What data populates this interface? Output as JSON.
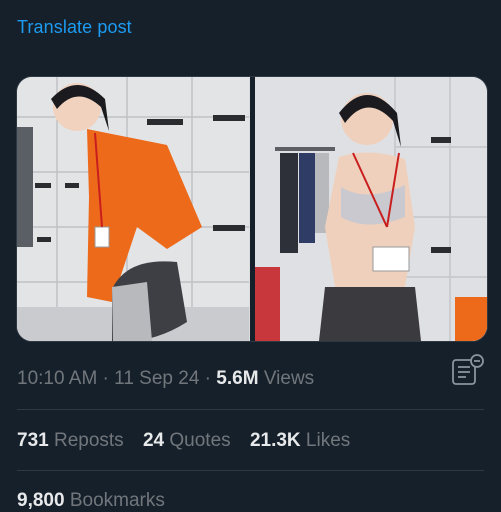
{
  "post": {
    "translate_label": "Translate post",
    "meta": {
      "time": "10:10 AM",
      "separator1": " · ",
      "date": "11 Sep 24",
      "separator2": " · ",
      "views_count": "5.6M",
      "views_label": " Views"
    },
    "stats": {
      "reposts_count": "731",
      "reposts_label": " Reposts",
      "quotes_count": "24",
      "quotes_label": " Quotes",
      "likes_count": "21.3K",
      "likes_label": " Likes"
    },
    "bookmarks": {
      "count": "9,800",
      "label": " Bookmarks"
    },
    "media": [
      {
        "icon": "photo-left"
      },
      {
        "icon": "photo-right"
      }
    ],
    "icons": {
      "analytics": "analytics-icon"
    },
    "colors": {
      "accent": "#1d9bf0",
      "background": "#16202b",
      "muted": "#71767b",
      "text": "#e7e9ea"
    }
  }
}
